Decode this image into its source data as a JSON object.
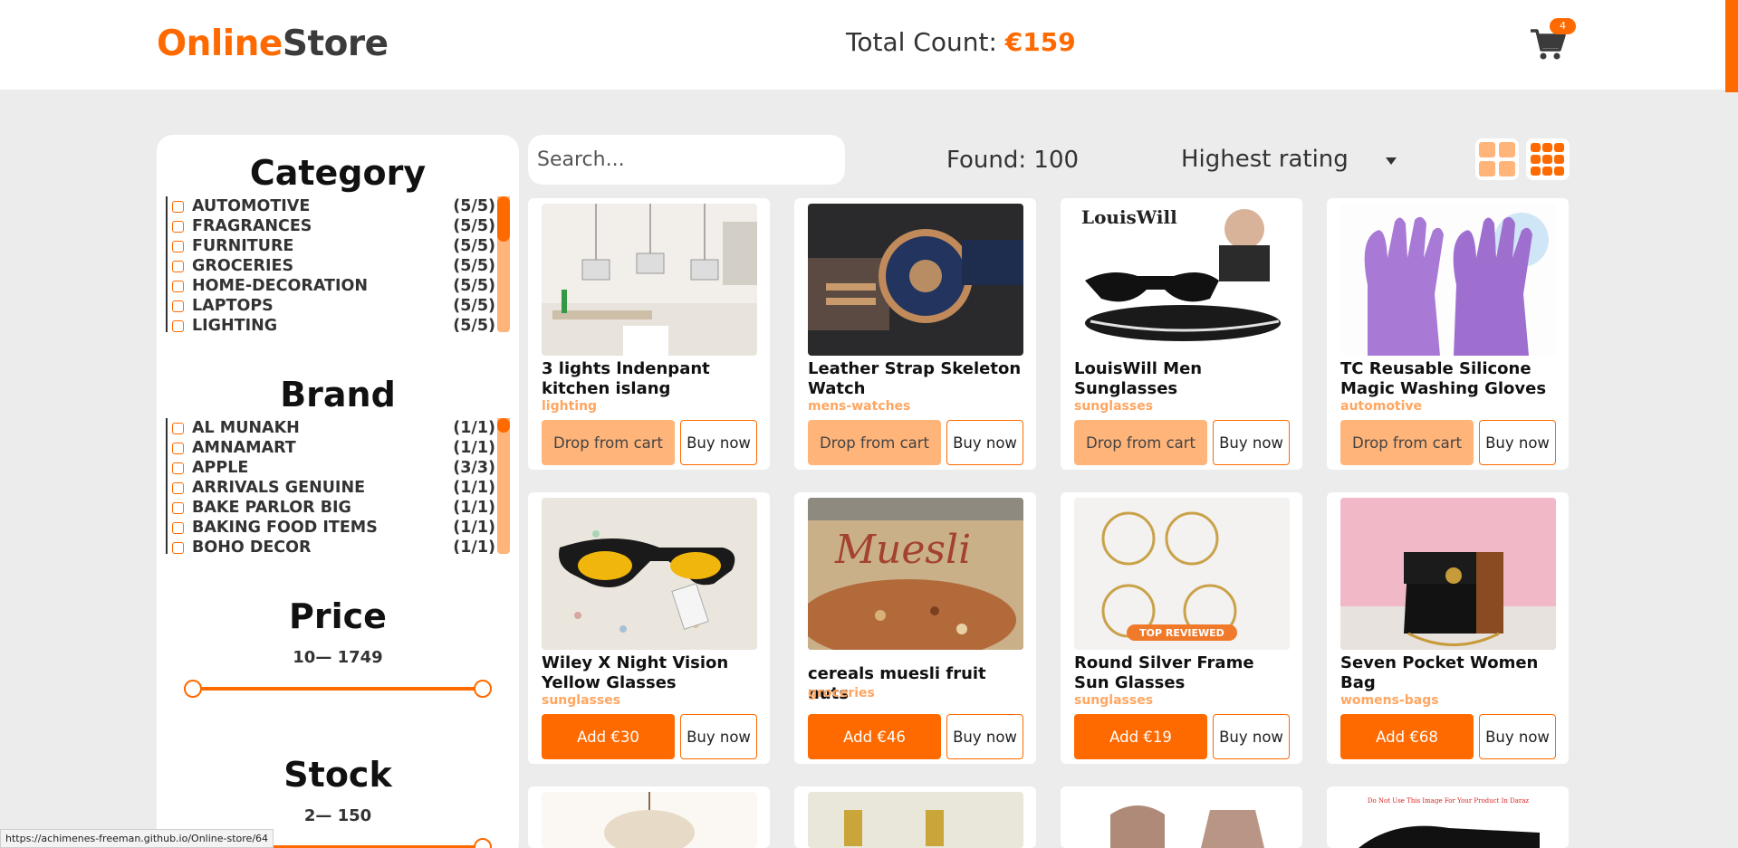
{
  "header": {
    "logo_part1": "Online",
    "logo_part2": "Store",
    "total_label": "Total Count:",
    "total_value": "€159",
    "cart_count": "4",
    "cart_icon": "cart-icon",
    "accent_color": "#ff6a00"
  },
  "sidebar": {
    "category": {
      "title": "Category",
      "items": [
        {
          "label": "AUTOMOTIVE",
          "count": "(5/5)"
        },
        {
          "label": "FRAGRANCES",
          "count": "(5/5)"
        },
        {
          "label": "FURNITURE",
          "count": "(5/5)"
        },
        {
          "label": "GROCERIES",
          "count": "(5/5)"
        },
        {
          "label": "HOME-DECORATION",
          "count": "(5/5)"
        },
        {
          "label": "LAPTOPS",
          "count": "(5/5)"
        },
        {
          "label": "LIGHTING",
          "count": "(5/5)"
        }
      ]
    },
    "brand": {
      "title": "Brand",
      "items": [
        {
          "label": "AL MUNAKH",
          "count": "(1/1)"
        },
        {
          "label": "AMNAMART",
          "count": "(1/1)"
        },
        {
          "label": "APPLE",
          "count": "(3/3)"
        },
        {
          "label": "ARRIVALS GENUINE",
          "count": "(1/1)"
        },
        {
          "label": "BAKE PARLOR BIG",
          "count": "(1/1)"
        },
        {
          "label": "BAKING FOOD ITEMS",
          "count": "(1/1)"
        },
        {
          "label": "BOHO DECOR",
          "count": "(1/1)"
        }
      ]
    },
    "price": {
      "title": "Price",
      "range": "10— 1749"
    },
    "stock": {
      "title": "Stock",
      "range": "2— 150"
    }
  },
  "toolbar": {
    "search_placeholder": "Search...",
    "found": "Found: 100",
    "sort_selected": "Highest rating"
  },
  "products": [
    {
      "title": "3 lights lndenpant kitchen islang",
      "category": "lighting",
      "main_label": "Drop from cart",
      "buy_label": "Buy now"
    },
    {
      "title": "Leather Strap Skeleton Watch",
      "category": "mens-watches",
      "main_label": "Drop from cart",
      "buy_label": "Buy now"
    },
    {
      "title": "LouisWill Men Sunglasses",
      "category": "sunglasses",
      "main_label": "Drop from cart",
      "buy_label": "Buy now",
      "img_text": "LouisWill"
    },
    {
      "title": "TC Reusable Silicone Magic Washing Gloves",
      "category": "automotive",
      "main_label": "Drop from cart",
      "buy_label": "Buy now"
    },
    {
      "title": "Wiley X Night Vision Yellow Glasses",
      "category": "sunglasses",
      "main_label": "Add €30",
      "buy_label": "Buy now"
    },
    {
      "title": "cereals muesli fruit nuts",
      "category": "groceries",
      "main_label": "Add €46",
      "buy_label": "Buy now",
      "img_text": "Muesli"
    },
    {
      "title": "Round Silver Frame Sun Glasses",
      "category": "sunglasses",
      "main_label": "Add €19",
      "buy_label": "Buy now",
      "img_text": "TOP REVIEWED"
    },
    {
      "title": "Seven Pocket Women Bag",
      "category": "womens-bags",
      "main_label": "Add €68",
      "buy_label": "Buy now"
    }
  ],
  "partial_row": {
    "img_text": "Do Not Use This Image For Your Product In Daraz"
  },
  "status_url": "https://achimenes-freeman.github.io/Online-store/64"
}
